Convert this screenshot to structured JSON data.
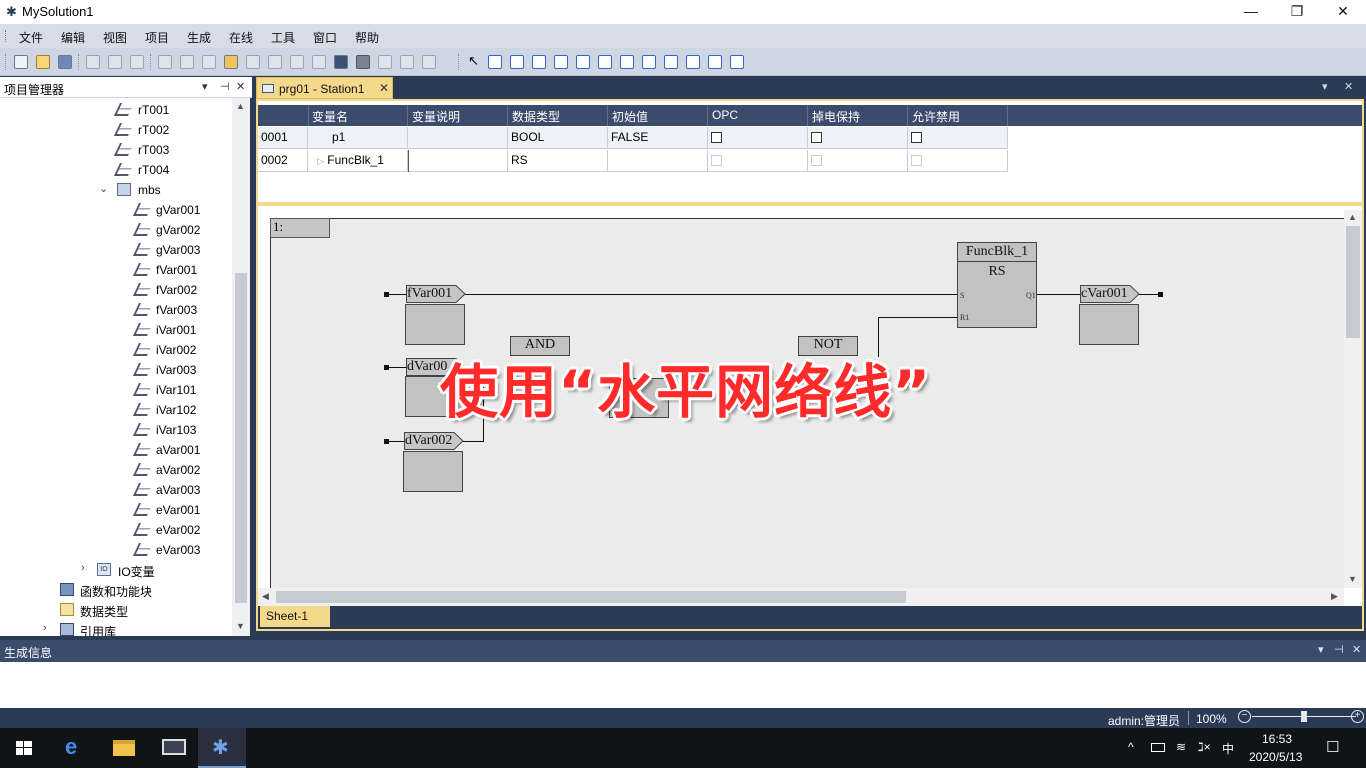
{
  "window": {
    "title": "MySolution1",
    "minimize": "—",
    "restore": "❐",
    "close": "✕"
  },
  "menu": [
    "文件",
    "编辑",
    "视图",
    "项目",
    "生成",
    "在线",
    "工具",
    "窗口",
    "帮助"
  ],
  "project_panel": {
    "title": "项目管理器",
    "controls": {
      "dropdown": "▾",
      "pin": "⊣",
      "close": "✕"
    },
    "items": [
      {
        "label": "rT001",
        "icon": "variable-icon"
      },
      {
        "label": "rT002",
        "icon": "variable-icon"
      },
      {
        "label": "rT003",
        "icon": "variable-icon"
      },
      {
        "label": "rT004",
        "icon": "variable-icon"
      },
      {
        "label": "mbs",
        "icon": "folder-icon",
        "expanded": true
      },
      {
        "label": "gVar001",
        "icon": "variable-icon"
      },
      {
        "label": "gVar002",
        "icon": "variable-icon"
      },
      {
        "label": "gVar003",
        "icon": "variable-icon"
      },
      {
        "label": "fVar001",
        "icon": "variable-icon"
      },
      {
        "label": "fVar002",
        "icon": "variable-icon"
      },
      {
        "label": "fVar003",
        "icon": "variable-icon"
      },
      {
        "label": "iVar001",
        "icon": "variable-icon"
      },
      {
        "label": "iVar002",
        "icon": "variable-icon"
      },
      {
        "label": "iVar003",
        "icon": "variable-icon"
      },
      {
        "label": "iVar101",
        "icon": "variable-icon"
      },
      {
        "label": "iVar102",
        "icon": "variable-icon"
      },
      {
        "label": "iVar103",
        "icon": "variable-icon"
      },
      {
        "label": "aVar001",
        "icon": "variable-icon"
      },
      {
        "label": "aVar002",
        "icon": "variable-icon"
      },
      {
        "label": "aVar003",
        "icon": "variable-icon"
      },
      {
        "label": "eVar001",
        "icon": "variable-icon"
      },
      {
        "label": "eVar002",
        "icon": "variable-icon"
      },
      {
        "label": "eVar003",
        "icon": "variable-icon"
      },
      {
        "label": "IO变量",
        "icon": "io-icon",
        "expanded": false
      },
      {
        "label": "函数和功能块",
        "icon": "function-block-icon"
      },
      {
        "label": "数据类型",
        "icon": "data-type-icon"
      },
      {
        "label": "引用库",
        "icon": "library-icon",
        "expanded": false
      }
    ]
  },
  "document": {
    "tab_label": "prg01 - Station1",
    "tab_close": "✕",
    "controls": {
      "dropdown": "▾",
      "close": "✕"
    },
    "var_table": {
      "headers": [
        "变量名",
        "变量说明",
        "数据类型",
        "初始值",
        "OPC",
        "掉电保持",
        "允许禁用"
      ],
      "rows": [
        {
          "no": "0001",
          "name": "p1",
          "desc": "",
          "type": "BOOL",
          "init": "FALSE",
          "opc": false,
          "retain": false,
          "allow_disable": false
        },
        {
          "no": "0002",
          "name": "FuncBlk_1",
          "desc": "",
          "type": "RS",
          "init": "",
          "opc": false,
          "retain": false,
          "allow_disable": false
        }
      ]
    },
    "network_label": "1:",
    "blocks": {
      "fb_instance": "FuncBlk_1",
      "fb_type": "RS",
      "pin_s": "S",
      "pin_r1": "R1",
      "pin_q1": "Q1",
      "and_gate": "AND",
      "not_gate": "NOT"
    },
    "vars": {
      "in1": "fVar001",
      "in2": "dVar00",
      "in3": "dVar002",
      "out1": "cVar001"
    },
    "sheet_tab": "Sheet-1"
  },
  "output_panel": {
    "title": "生成信息",
    "controls": {
      "dropdown": "▾",
      "pin": "⊣",
      "close": "✕"
    }
  },
  "status": {
    "user": "admin:管理员",
    "zoom": "100%",
    "zoom_minus": "−",
    "zoom_plus": "+",
    "zoom_level": 0.5
  },
  "taskbar": {
    "time": "16:53",
    "date": "2020/5/13",
    "ime": "中",
    "tray_chevron": "^",
    "volume": "ℷ×",
    "notifications": "☐"
  },
  "overlay_caption": "使用“水平网络线”"
}
